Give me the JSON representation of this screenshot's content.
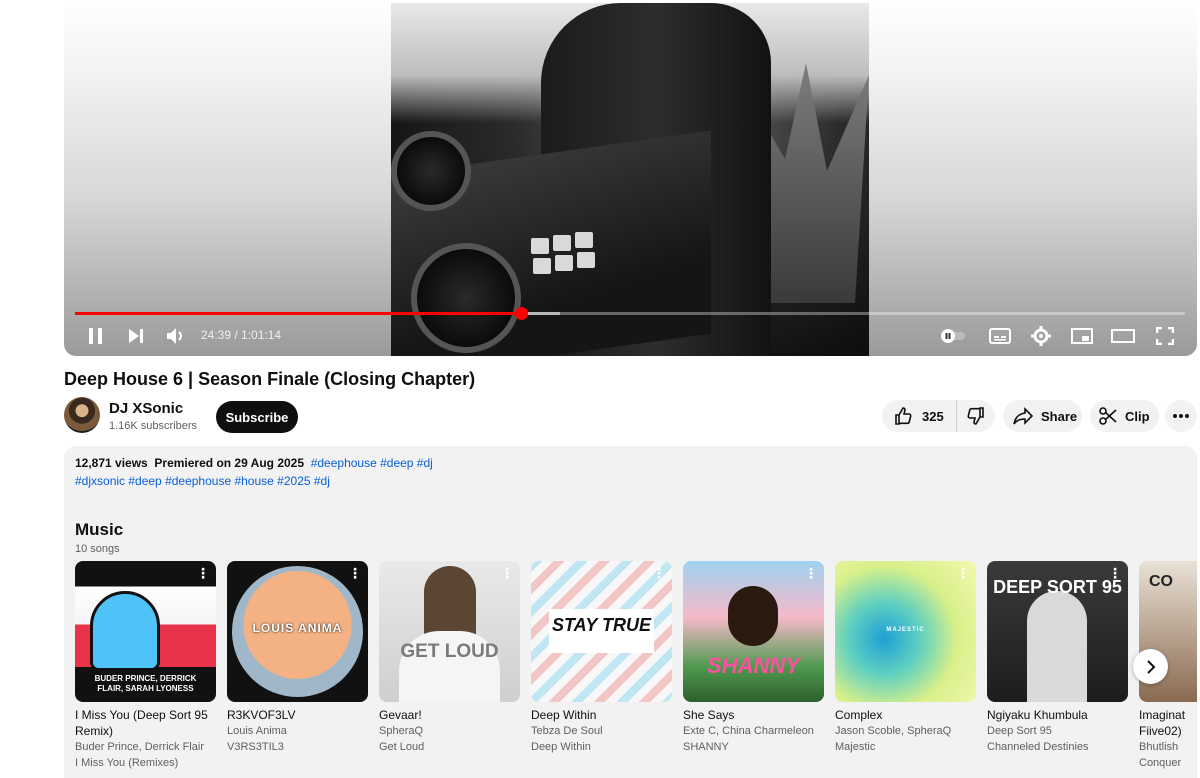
{
  "player": {
    "current_time": "24:39",
    "duration": "1:01:14",
    "time_display": "24:39 / 1:01:14",
    "progress_played_fraction": 0.402,
    "progress_loaded_fraction": 0.437,
    "icons": [
      "pause-icon",
      "next-icon",
      "volume-icon",
      "autoplay-toggle-icon",
      "captions-icon",
      "settings-icon",
      "miniplayer-icon",
      "theater-icon",
      "fullscreen-icon"
    ],
    "accent_color": "#ff0000"
  },
  "video": {
    "title": "Deep House 6 | Season Finale (Closing Chapter)"
  },
  "channel": {
    "name": "DJ XSonic",
    "subscribers": "1.16K subscribers",
    "subscribe_label": "Subscribe"
  },
  "actions": {
    "like_count": "325",
    "share_label": "Share",
    "clip_label": "Clip"
  },
  "description": {
    "views": "12,871 views",
    "premiered": "Premiered on 29 Aug 2025",
    "tags_line1": "#deephouse #deep #dj",
    "tags_line2": "#djxsonic #deep #deephouse #house #2025 #dj"
  },
  "music": {
    "heading": "Music",
    "count": "10 songs",
    "songs": [
      {
        "title": "I Miss You (Deep Sort 95 Remix)",
        "artist": "Buder Prince, Derrick Flair",
        "album": "I Miss You (Remixes)",
        "cover_text": "BUDER PRINCE, DERRICK FLAIR, SARAH LYONESS"
      },
      {
        "title": "R3KVOF3LV",
        "artist": "Louis Anima",
        "album": "V3RS3TIL3",
        "cover_text": "LOUIS ANIMA"
      },
      {
        "title": "Gevaar!",
        "artist": "SpheraQ",
        "album": "Get Loud",
        "cover_text": "GET LOUD"
      },
      {
        "title": "Deep Within",
        "artist": "Tebza De Soul",
        "album": "Deep Within",
        "cover_text": "STAY TRUE"
      },
      {
        "title": "She Says",
        "artist": "Exte C, China Charmeleon",
        "album": "SHANNY",
        "cover_text": "SHANNY"
      },
      {
        "title": "Complex",
        "artist": "Jason Scoble, SpheraQ",
        "album": "Majestic",
        "cover_text": "MAJESTIC"
      },
      {
        "title": "Ngiyaku Khumbula",
        "artist": "Deep Sort 95",
        "album": "Channeled Destinies",
        "cover_text": "DEEP SORT 95"
      },
      {
        "title": "Imaginat Fiive02)",
        "artist": "Bhutlish",
        "album": "Conquer",
        "cover_text": "CO"
      }
    ]
  }
}
